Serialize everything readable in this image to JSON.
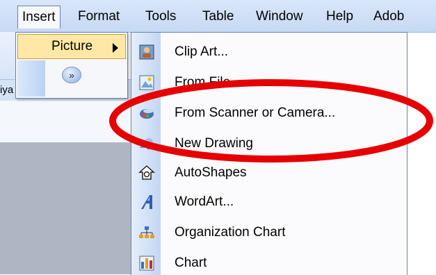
{
  "menubar": {
    "items": [
      {
        "label": "Insert"
      },
      {
        "label": "Format"
      },
      {
        "label": "Tools"
      },
      {
        "label": "Table"
      },
      {
        "label": "Window"
      },
      {
        "label": "Help"
      },
      {
        "label": "Adob"
      }
    ]
  },
  "document": {
    "font_strip_text": "iya No ▾ Minya No"
  },
  "insert_menu": {
    "picture_label": "Picture"
  },
  "picture_submenu": {
    "items": [
      {
        "label": "Clip Art...",
        "icon": "clip-art-icon"
      },
      {
        "label": "From File",
        "icon": "from-file-icon"
      },
      {
        "label": "From Scanner or Camera...",
        "icon": "scanner-camera-icon"
      },
      {
        "label": "New Drawing",
        "icon": "new-drawing-icon"
      },
      {
        "label": "AutoShapes",
        "icon": "autoshapes-icon"
      },
      {
        "label": "WordArt...",
        "icon": "wordart-icon"
      },
      {
        "label": "Organization Chart",
        "icon": "organization-chart-icon"
      },
      {
        "label": "Chart",
        "icon": "chart-icon"
      }
    ]
  },
  "colors": {
    "highlight": "#e60000",
    "menu_hover": "#ffe8a6",
    "menubar_bg": "#c6d9f4"
  }
}
